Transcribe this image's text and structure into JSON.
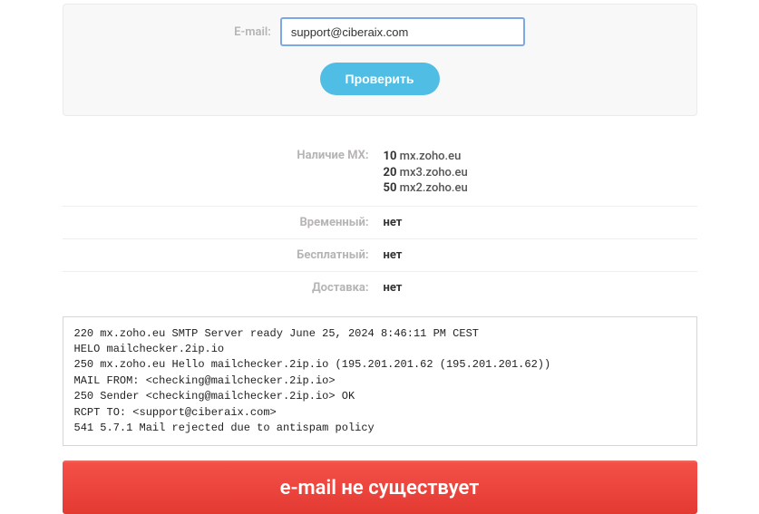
{
  "form": {
    "label": "E-mail:",
    "value": "support@ciberaix.com",
    "button": "Проверить"
  },
  "results": {
    "mx_label": "Наличие MX:",
    "mx_records": [
      {
        "priority": "10",
        "host": "mx.zoho.eu"
      },
      {
        "priority": "20",
        "host": "mx3.zoho.eu"
      },
      {
        "priority": "50",
        "host": "mx2.zoho.eu"
      }
    ],
    "temporary_label": "Временный:",
    "temporary_value": "нет",
    "free_label": "Бесплатный:",
    "free_value": "нет",
    "delivery_label": "Доставка:",
    "delivery_value": "нет"
  },
  "smtp_log": "220 mx.zoho.eu SMTP Server ready June 25, 2024 8:46:11 PM CEST\nHELO mailchecker.2ip.io\n250 mx.zoho.eu Hello mailchecker.2ip.io (195.201.201.62 (195.201.201.62))\nMAIL FROM: <checking@mailchecker.2ip.io>\n250 Sender <checking@mailchecker.2ip.io> OK\nRCPT TO: <support@ciberaix.com>\n541 5.7.1 Mail rejected due to antispam policy",
  "banner": "e-mail не существует"
}
